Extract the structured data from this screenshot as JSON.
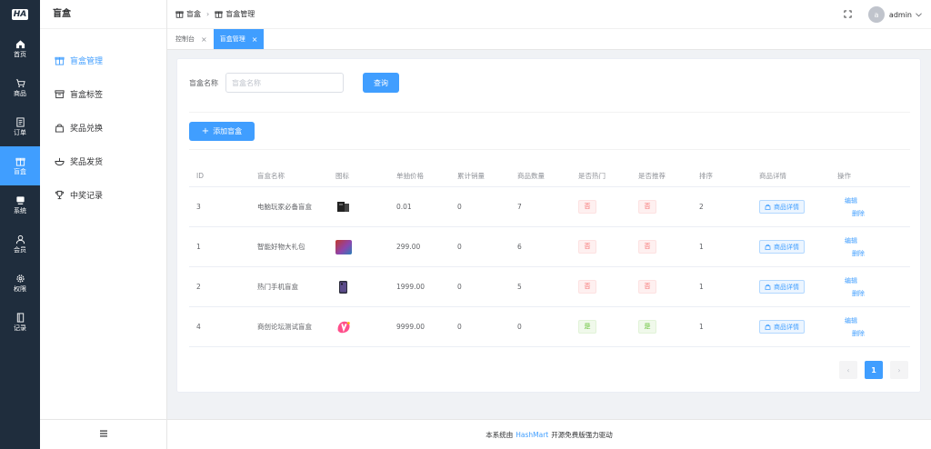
{
  "rail": {
    "logo": "HA",
    "items": [
      {
        "label": "首页",
        "icon": "home-icon"
      },
      {
        "label": "商品",
        "icon": "cart-icon"
      },
      {
        "label": "订单",
        "icon": "order-icon"
      },
      {
        "label": "盲盒",
        "icon": "box-icon"
      },
      {
        "label": "系统",
        "icon": "monitor-icon"
      },
      {
        "label": "会员",
        "icon": "user-icon"
      },
      {
        "label": "权限",
        "icon": "gear-icon"
      },
      {
        "label": "记录",
        "icon": "notebook-icon"
      }
    ]
  },
  "submenu": {
    "title": "盲盒",
    "items": [
      {
        "label": "盲盒管理",
        "icon": "box-icon"
      },
      {
        "label": "盲盒标签",
        "icon": "folder-icon"
      },
      {
        "label": "奖品兑换",
        "icon": "bag-icon"
      },
      {
        "label": "奖品发货",
        "icon": "bowl-icon"
      },
      {
        "label": "中奖记录",
        "icon": "trophy-icon"
      }
    ]
  },
  "header": {
    "breadcrumb": [
      "盲盒",
      "盲盒管理"
    ],
    "user": "admin",
    "avatar_letter": "a"
  },
  "tabs": [
    {
      "label": "控制台",
      "close": "×"
    },
    {
      "label": "盲盒管理",
      "close": "×"
    }
  ],
  "search": {
    "label": "盲盒名称",
    "placeholder": "盲盒名称",
    "button": "查询"
  },
  "add_button": "添加盲盒",
  "table": {
    "columns": [
      "ID",
      "盲盒名称",
      "图标",
      "单抽价格",
      "累计销量",
      "商品数量",
      "是否热门",
      "是否推荐",
      "排序",
      "商品详情",
      "操作"
    ],
    "rows": [
      {
        "id": "3",
        "name": "电脑玩家必备盲盒",
        "price": "0.01",
        "sales": "0",
        "count": "7",
        "hot": "否",
        "recommend": "否",
        "sort": "2",
        "detail": "商品详情",
        "edit": "编辑",
        "delete": "删除"
      },
      {
        "id": "1",
        "name": "智能好物大礼包",
        "price": "299.00",
        "sales": "0",
        "count": "6",
        "hot": "否",
        "recommend": "否",
        "sort": "1",
        "detail": "商品详情",
        "edit": "编辑",
        "delete": "删除"
      },
      {
        "id": "2",
        "name": "热门手机盲盒",
        "price": "1999.00",
        "sales": "0",
        "count": "5",
        "hot": "否",
        "recommend": "否",
        "sort": "1",
        "detail": "商品详情",
        "edit": "编辑",
        "delete": "删除"
      },
      {
        "id": "4",
        "name": "商创论坛测试盲盒",
        "price": "9999.00",
        "sales": "0",
        "count": "0",
        "hot": "是",
        "recommend": "是",
        "sort": "1",
        "detail": "商品详情",
        "edit": "编辑",
        "delete": "删除"
      }
    ]
  },
  "pager": {
    "prev": "‹",
    "current": "1",
    "next": "›"
  },
  "footer": {
    "prefix": "本系统由",
    "brand": "HashMart",
    "suffix": "开源免费版强力驱动"
  },
  "colors": {
    "primary": "#409eff",
    "rail": "#1f2d3d",
    "danger": "#f56c6c",
    "success": "#67c23a"
  }
}
